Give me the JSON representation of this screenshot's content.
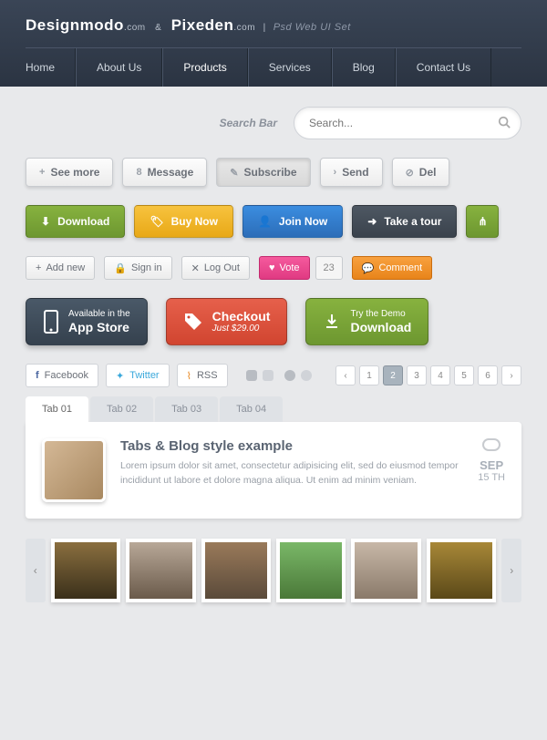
{
  "header": {
    "brand1": "Designmodo",
    "brand1_sm": ".com",
    "amp": "&",
    "brand2": "Pixeden",
    "brand2_sm": ".com",
    "sub": "Psd Web UI Set"
  },
  "nav": [
    "Home",
    "About Us",
    "Products",
    "Services",
    "Blog",
    "Contact Us"
  ],
  "search": {
    "label": "Search Bar",
    "placeholder": "Search..."
  },
  "grey_buttons": [
    {
      "icon": "+",
      "label": "See more"
    },
    {
      "icon": "8",
      "label": "Message"
    },
    {
      "icon": "✎",
      "label": "Subscribe",
      "active": true
    },
    {
      "icon": "›",
      "label": "Send"
    },
    {
      "icon": "⊘",
      "label": "Del"
    }
  ],
  "color_buttons": [
    {
      "cls": "green",
      "icon": "⬇",
      "label": "Download"
    },
    {
      "cls": "yellow",
      "icon": "🏷",
      "label": "Buy Now"
    },
    {
      "cls": "blue",
      "icon": "👤",
      "label": "Join Now"
    },
    {
      "cls": "dark",
      "icon": "➜",
      "label": "Take a tour"
    }
  ],
  "small_buttons": [
    {
      "cls": "",
      "icon": "+",
      "label": "Add new"
    },
    {
      "cls": "",
      "icon": "🔒",
      "label": "Sign in"
    },
    {
      "cls": "",
      "icon": "✕",
      "label": "Log Out"
    },
    {
      "cls": "pink",
      "icon": "♥",
      "label": "Vote",
      "badge": "23"
    },
    {
      "cls": "orange",
      "icon": "💬",
      "label": "Comment"
    }
  ],
  "big_buttons": [
    {
      "cls": "bb-navy",
      "icon": "phone",
      "t1": "Available in the",
      "t2": "App Store"
    },
    {
      "cls": "bb-red",
      "icon": "tag",
      "t1": "Checkout",
      "t2": "Just $29.00",
      "swap": true
    },
    {
      "cls": "bb-green",
      "icon": "dl",
      "t1": "Try the Demo",
      "t2": "Download"
    }
  ],
  "social": [
    {
      "icon": "f",
      "label": "Facebook",
      "cls": ""
    },
    {
      "icon": "t",
      "label": "Twitter",
      "cls": "twitter"
    },
    {
      "icon": "r",
      "label": "RSS",
      "cls": ""
    }
  ],
  "pages": [
    "‹",
    "1",
    "2",
    "3",
    "4",
    "5",
    "6",
    "›"
  ],
  "tabs": [
    "Tab 01",
    "Tab 02",
    "Tab 03",
    "Tab 04"
  ],
  "post": {
    "title": "Tabs & Blog style example",
    "body": "Lorem ipsum dolor sit amet, consectetur adipisicing elit, sed do eiusmod tempor incididunt ut labore et dolore magna aliqua. Ut enim ad minim veniam.",
    "month": "SEP",
    "day": "15 TH"
  }
}
